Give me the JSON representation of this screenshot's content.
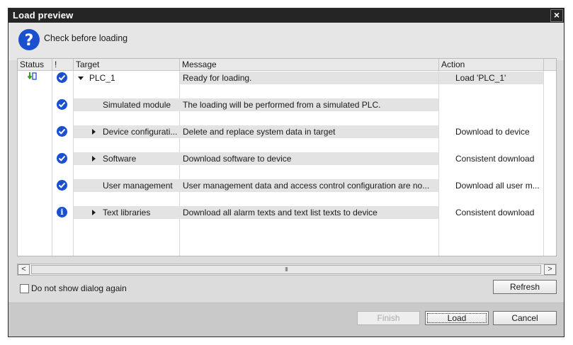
{
  "dialog": {
    "title": "Load preview",
    "close_symbol": "×",
    "header_text": "Check before loading",
    "header_icon": "question-icon"
  },
  "grid": {
    "columns": [
      "Status",
      "!",
      "Target",
      "Message",
      "Action"
    ],
    "rows": [
      {
        "status_icon": "download-status-icon",
        "check": "check",
        "target": "PLC_1",
        "expander": "expanded",
        "message": "Ready for loading.",
        "action": "Load 'PLC_1'"
      },
      {
        "check": "check",
        "target": "Simulated module",
        "expander": "none",
        "message": "The loading will be performed from a simulated PLC.",
        "action": ""
      },
      {
        "check": "check",
        "target": "Device configurati...",
        "expander": "collapsed",
        "message": "Delete and replace system data in target",
        "action": "Download to device"
      },
      {
        "check": "check",
        "target": "Software",
        "expander": "collapsed",
        "message": "Download software to device",
        "action": "Consistent download"
      },
      {
        "check": "check",
        "target": "User management",
        "expander": "none",
        "message": "User management data and access control configuration are no...",
        "action": "Download all user m..."
      },
      {
        "check": "info",
        "target": "Text libraries",
        "expander": "collapsed",
        "message": "Download all alarm texts and text list texts to device",
        "action": "Consistent download"
      }
    ]
  },
  "scrollbar": {
    "left_arrow": "<",
    "right_arrow": ">",
    "thumb_grip": "III"
  },
  "options": {
    "do_not_show_label": "Do not show dialog again",
    "do_not_show_checked": false
  },
  "buttons": {
    "refresh": "Refresh",
    "finish": "Finish",
    "load": "Load",
    "cancel": "Cancel"
  },
  "colors": {
    "titlebar": "#252525",
    "accent_icon": "#1a4fcf",
    "dialog_bg": "#dcdcdc"
  }
}
